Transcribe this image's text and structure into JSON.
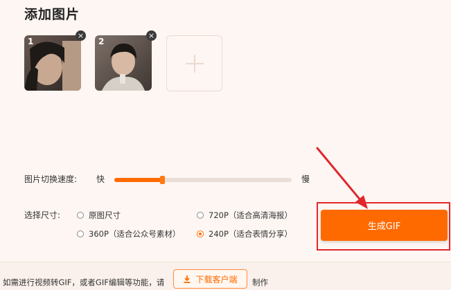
{
  "title": "添加图片",
  "images": [
    {
      "number": "1",
      "close": "×"
    },
    {
      "number": "2",
      "close": "×"
    }
  ],
  "add_tile": {
    "icon": "plus-icon"
  },
  "speed": {
    "label": "图片切换速度:",
    "fast": "快",
    "slow": "慢",
    "value": 0.27
  },
  "size": {
    "label": "选择尺寸:",
    "options": [
      {
        "label": "原图尺寸",
        "checked": false
      },
      {
        "label": "720P（适合高清海报）",
        "checked": false
      },
      {
        "label": "360P（适合公众号素材）",
        "checked": false
      },
      {
        "label": "240P（适合表情分享）",
        "checked": true
      }
    ]
  },
  "generate_button": "生成GIF",
  "bottom": {
    "text_before": "如需进行视频转GIF，或者GIF编辑等功能，请",
    "download_button": "下载客户端",
    "text_after": "制作"
  },
  "colors": {
    "accent": "#ff6a00",
    "highlight": "#e0262b"
  }
}
